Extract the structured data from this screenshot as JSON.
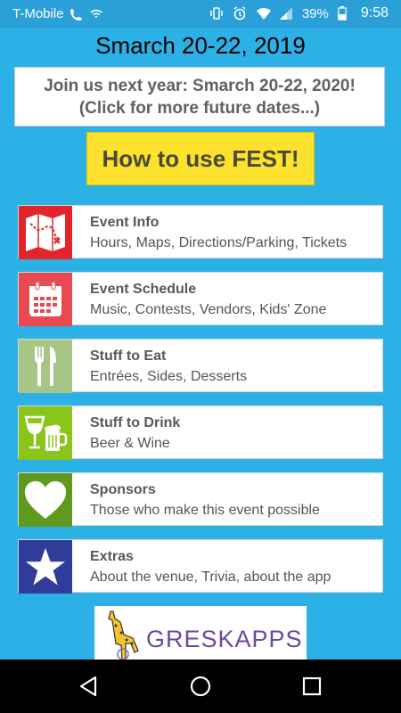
{
  "status_bar": {
    "carrier": "T-Mobile",
    "battery_percent": "39%",
    "time": "9:58",
    "icons": [
      "wifi-calling-icon",
      "vpn-icon",
      "vibrate-icon",
      "alarm-icon",
      "wifi-icon",
      "signal-icon",
      "battery-icon"
    ]
  },
  "header": {
    "title": "Smarch 20-22, 2019",
    "notice_line1": "Join us next year: Smarch 20-22, 2020!",
    "notice_line2": "(Click for more future dates...)",
    "howto_label": "How to use FEST!"
  },
  "menu": [
    {
      "title": "Event Info",
      "subtitle": "Hours, Maps, Directions/Parking, Tickets",
      "icon": "map-icon",
      "color": "#e3242b"
    },
    {
      "title": "Event Schedule",
      "subtitle": "Music, Contests, Vendors, Kids' Zone",
      "icon": "calendar-icon",
      "color": "#e84a52"
    },
    {
      "title": "Stuff to Eat",
      "subtitle": "Entrées, Sides, Desserts",
      "icon": "fork-knife-icon",
      "color": "#a7c686"
    },
    {
      "title": "Stuff to Drink",
      "subtitle": "Beer & Wine",
      "icon": "drinks-icon",
      "color": "#8ac51b"
    },
    {
      "title": "Sponsors",
      "subtitle": "Those who make this event possible",
      "icon": "heart-icon",
      "color": "#5f9a1e"
    },
    {
      "title": "Extras",
      "subtitle": "About the venue, Trivia, about the app",
      "icon": "star-icon",
      "color": "#2f3c9a"
    }
  ],
  "sponsor_banner": {
    "text": "GRESKAPPS",
    "icon": "giraffe-logo-icon"
  },
  "nav_bar": {
    "icons": [
      "back-icon",
      "home-icon",
      "recents-icon"
    ]
  }
}
